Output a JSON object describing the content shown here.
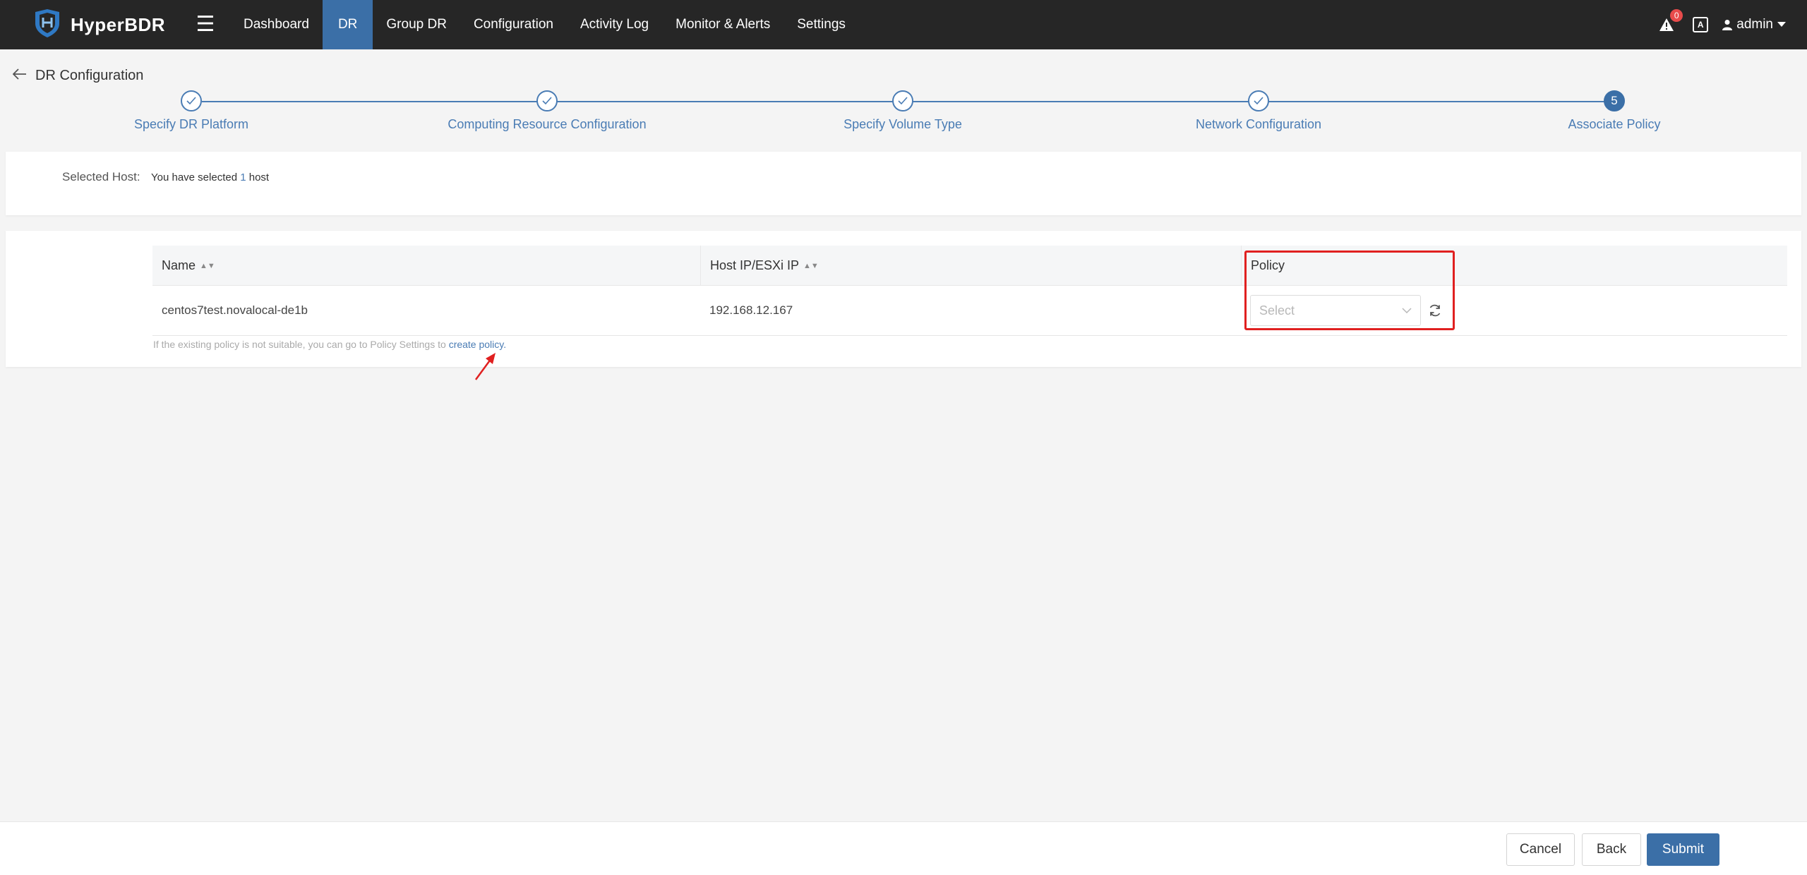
{
  "app": {
    "name": "HyperBDR"
  },
  "nav": {
    "items": [
      "Dashboard",
      "DR",
      "Group DR",
      "Configuration",
      "Activity Log",
      "Monitor & Alerts",
      "Settings"
    ],
    "active": "DR"
  },
  "header_right": {
    "alert_count": "0",
    "lang_icon": "A",
    "user": "admin"
  },
  "page": {
    "title": "DR Configuration"
  },
  "steps": [
    {
      "label": "Specify DR Platform",
      "status": "done"
    },
    {
      "label": "Computing Resource Configuration",
      "status": "done"
    },
    {
      "label": "Specify Volume Type",
      "status": "done"
    },
    {
      "label": "Network Configuration",
      "status": "done"
    },
    {
      "label": "Associate Policy",
      "status": "current",
      "number": "5"
    }
  ],
  "selected_host": {
    "label": "Selected Host:",
    "prefix": "You have selected",
    "count": "1",
    "suffix": "host"
  },
  "table": {
    "columns": {
      "name": "Name",
      "ip": "Host IP/ESXi IP",
      "policy": "Policy"
    },
    "rows": [
      {
        "name": "centos7test.novalocal-de1b",
        "ip": "192.168.12.167",
        "policy_placeholder": "Select"
      }
    ],
    "hint_text": "If the existing policy is not suitable, you can go to Policy Settings to",
    "hint_link": "create policy."
  },
  "footer": {
    "cancel": "Cancel",
    "back": "Back",
    "submit": "Submit"
  },
  "colors": {
    "accent": "#3b6fa7",
    "topbar": "#262626",
    "highlight": "#e02020"
  }
}
